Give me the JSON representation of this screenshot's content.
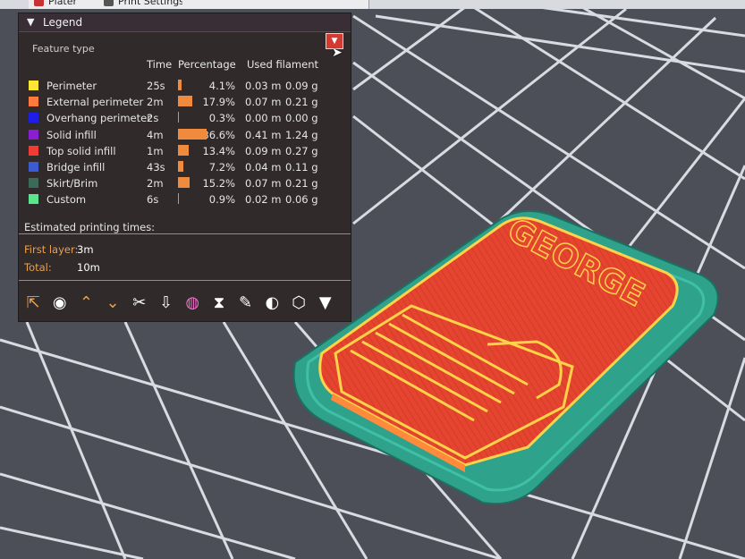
{
  "tabs": [
    {
      "label": "Plater",
      "icon": "plater-icon"
    },
    {
      "label": "Print Settings",
      "icon": "print-settings-icon"
    }
  ],
  "legend": {
    "title": "Legend",
    "feature_type_label": "Feature type",
    "combo_icon": "dropdown-arrow-icon",
    "headers": {
      "time": "Time",
      "percentage": "Percentage",
      "used_filament": "Used filament"
    },
    "rows": [
      {
        "name": "Perimeter",
        "color": "#ffe632",
        "time": "25s",
        "pct": "4.1%",
        "pct_value": 4.1,
        "length": "0.03 m",
        "weight": "0.09 g"
      },
      {
        "name": "External perimeter",
        "color": "#ff7a3c",
        "time": "2m",
        "pct": "17.9%",
        "pct_value": 17.9,
        "length": "0.07 m",
        "weight": "0.21 g"
      },
      {
        "name": "Overhang perimeter",
        "color": "#1e1ee6",
        "time": "2s",
        "pct": "0.3%",
        "pct_value": 0.3,
        "length": "0.00 m",
        "weight": "0.00 g"
      },
      {
        "name": "Solid infill",
        "color": "#8a1ed2",
        "time": "4m",
        "pct": "36.6%",
        "pct_value": 36.6,
        "length": "0.41 m",
        "weight": "1.24 g"
      },
      {
        "name": "Top solid infill",
        "color": "#f03c32",
        "time": "1m",
        "pct": "13.4%",
        "pct_value": 13.4,
        "length": "0.09 m",
        "weight": "0.27 g"
      },
      {
        "name": "Bridge infill",
        "color": "#3c5ad2",
        "time": "43s",
        "pct": "7.2%",
        "pct_value": 7.2,
        "length": "0.04 m",
        "weight": "0.11 g"
      },
      {
        "name": "Skirt/Brim",
        "color": "#3c6a5a",
        "time": "2m",
        "pct": "15.2%",
        "pct_value": 15.2,
        "length": "0.07 m",
        "weight": "0.21 g"
      },
      {
        "name": "Custom",
        "color": "#5ae68c",
        "time": "6s",
        "pct": "0.9%",
        "pct_value": 0.9,
        "length": "0.02 m",
        "weight": "0.06 g"
      }
    ],
    "estimated_label": "Estimated printing times:",
    "first_layer_label": "First layer:",
    "first_layer_value": "3m",
    "total_label": "Total:",
    "total_value": "10m"
  },
  "toolbar_icons": [
    "travel-icon",
    "wipe-icon",
    "retractions-icon",
    "deretractions-icon",
    "seams-icon",
    "tool-changes-icon",
    "color-changes-icon",
    "pause-prints-icon",
    "custom-gcodes-icon",
    "center-of-gravity-icon",
    "shells-icon",
    "tool-marker-icon"
  ],
  "model": {
    "text": "GEORGE",
    "colors": {
      "top": "#e8442e",
      "perimeter": "#ffd24a",
      "brim": "#2a9c88",
      "background": "#4a4d55",
      "grid": "#dfe3ea"
    }
  }
}
